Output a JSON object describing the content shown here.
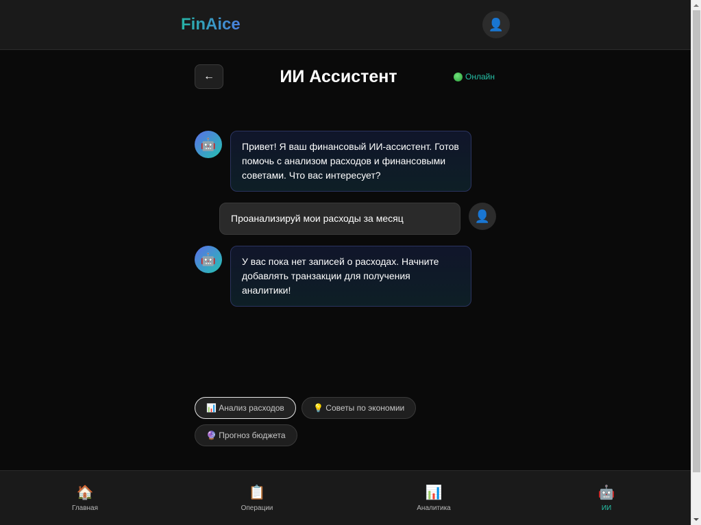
{
  "header": {
    "logo": "FinAice",
    "profile_icon": "👤"
  },
  "chat": {
    "back_icon": "←",
    "title": "ИИ Ассистент",
    "status_icon": "green-circle-icon",
    "status": "Онлайн",
    "bot_avatar": "🤖",
    "user_avatar": "👤",
    "messages": [
      {
        "role": "bot",
        "text": "Привет! Я ваш финансовый ИИ-ассистент. Готов помочь с анализом расходов и финансовыми советами. Что вас интересует?"
      },
      {
        "role": "user",
        "text": "Проанализируй мои расходы за месяц"
      },
      {
        "role": "bot",
        "text": "У вас пока нет записей о расходах. Начните добавлять транзакции для получения аналитики!"
      }
    ]
  },
  "quick_replies": [
    {
      "label": "📊 Анализ расходов",
      "active": true
    },
    {
      "label": "💡 Советы по экономии",
      "active": false
    },
    {
      "label": "🔮 Прогноз бюджета",
      "active": false
    }
  ],
  "bottom_nav": [
    {
      "icon": "🏠",
      "label": "Главная",
      "active": false
    },
    {
      "icon": "📋",
      "label": "Операции",
      "active": false
    },
    {
      "icon": "📊",
      "label": "Аналитика",
      "active": false
    },
    {
      "icon": "🤖",
      "label": "ИИ",
      "active": true
    }
  ],
  "colors": {
    "accent": "#26c2a8",
    "background": "#0a0a0a",
    "panel": "#1a1a1a"
  }
}
